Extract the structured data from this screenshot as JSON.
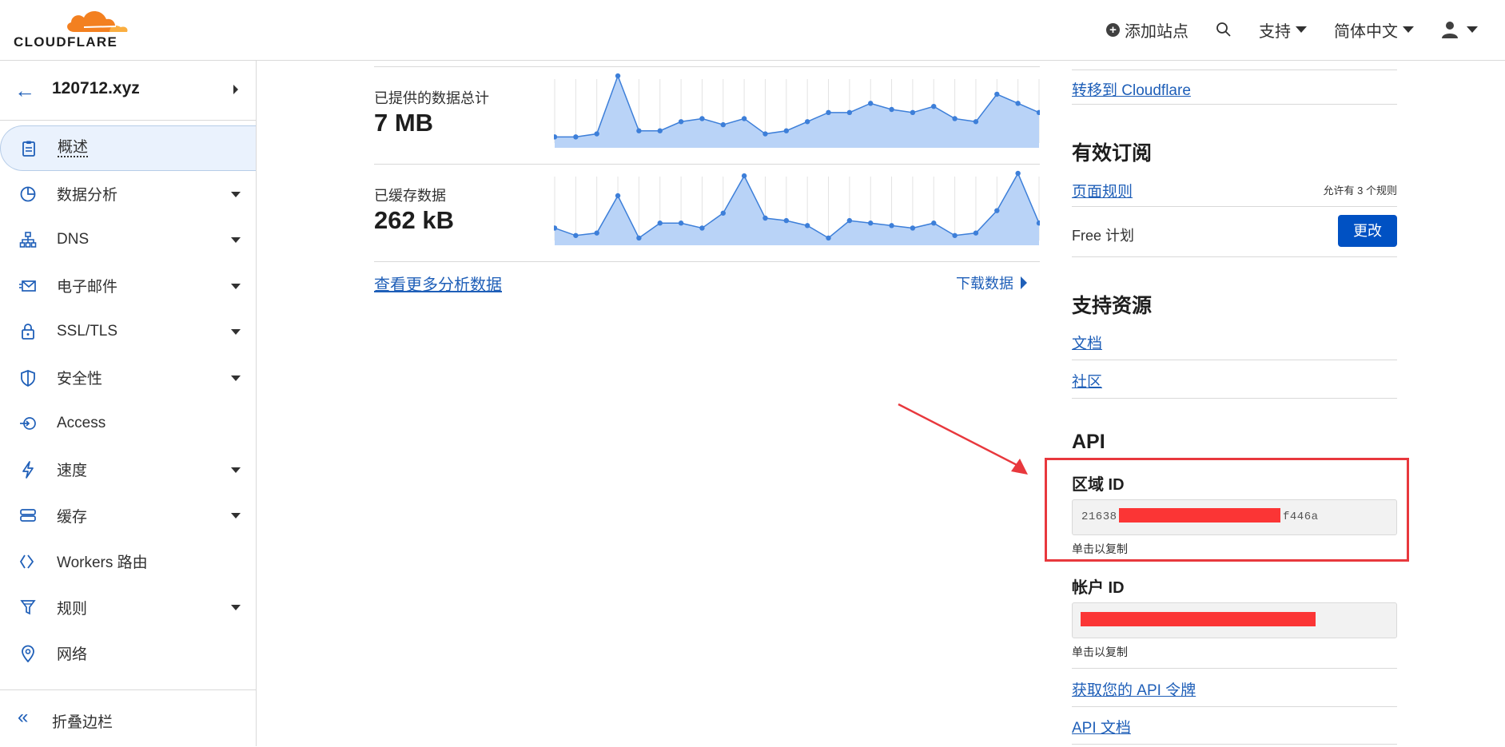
{
  "brand": {
    "logo_text": "CLOUDFLARE"
  },
  "topnav": {
    "add_site": "添加站点",
    "support": "支持",
    "language": "简体中文"
  },
  "sidebar": {
    "zone_name": "120712.xyz",
    "items": [
      {
        "label": "概述",
        "icon": "clipboard-icon",
        "active": true,
        "has_caret": false
      },
      {
        "label": "数据分析",
        "icon": "pie-chart-icon",
        "has_caret": true
      },
      {
        "label": "DNS",
        "icon": "network-icon",
        "has_caret": true
      },
      {
        "label": "电子邮件",
        "icon": "email-icon",
        "has_caret": true
      },
      {
        "label": "SSL/TLS",
        "icon": "lock-icon",
        "has_caret": true
      },
      {
        "label": "安全性",
        "icon": "shield-icon",
        "has_caret": true
      },
      {
        "label": "Access",
        "icon": "access-icon",
        "has_caret": false
      },
      {
        "label": "速度",
        "icon": "lightning-icon",
        "has_caret": true
      },
      {
        "label": "缓存",
        "icon": "cache-icon",
        "has_caret": true
      },
      {
        "label": "Workers 路由",
        "icon": "workers-icon",
        "has_caret": false
      },
      {
        "label": "规则",
        "icon": "funnel-icon",
        "has_caret": true
      },
      {
        "label": "网络",
        "icon": "location-pin-icon",
        "has_caret": false
      }
    ],
    "collapse_label": "折叠边栏"
  },
  "main": {
    "metrics": [
      {
        "label": "已提供的数据总计",
        "value": "7 MB"
      },
      {
        "label": "已缓存数据",
        "value": "262 kB"
      }
    ],
    "more_analytics": "查看更多分析数据",
    "download_data": "下载数据"
  },
  "chart_data": [
    {
      "type": "area",
      "values": [
        1,
        1,
        1.5,
        11,
        2,
        2,
        3.5,
        4,
        3,
        4,
        1.5,
        2,
        3.5,
        5,
        5,
        6.5,
        5.5,
        5,
        6,
        4,
        3.5,
        8,
        6.5,
        5
      ]
    },
    {
      "type": "area",
      "values": [
        2.5,
        1,
        1.5,
        9,
        0.5,
        3.5,
        3.5,
        2.5,
        5.5,
        13,
        4.5,
        4,
        3,
        0.5,
        4,
        3.5,
        3,
        2.5,
        3.5,
        1,
        1.5,
        6,
        13.5,
        3.5
      ]
    }
  ],
  "right": {
    "transfer_link": "转移到 Cloudflare",
    "subscriptions_title": "有效订阅",
    "page_rules_link": "页面规则",
    "page_rules_note": "允许有 3 个规则",
    "plan_name": "Free 计划",
    "change_button": "更改",
    "support_title": "支持资源",
    "docs_link": "文档",
    "community_link": "社区",
    "api_title": "API",
    "zone_id_label": "区域 ID",
    "zone_id_prefix": "21638",
    "zone_id_suffix": "f446a",
    "copy_hint": "单击以复制",
    "account_id_label": "帐户 ID",
    "account_copy_hint": "单击以复制",
    "api_token_link": "获取您的 API 令牌",
    "api_docs_link": "API 文档"
  },
  "colors": {
    "accent": "#0051c3",
    "link": "#1f5fb8",
    "chart_fill": "#b9d3f7",
    "chart_line": "#3d7fd9",
    "highlight": "#e8383d",
    "redaction": "#fb3535"
  }
}
